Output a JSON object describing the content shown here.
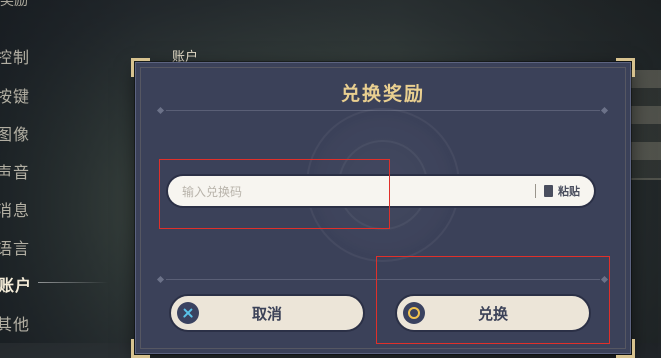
{
  "side_menu": {
    "header": "奖励",
    "items": [
      {
        "label": "控制",
        "active": false
      },
      {
        "label": "按键",
        "active": false
      },
      {
        "label": "图像",
        "active": false
      },
      {
        "label": "声音",
        "active": false
      },
      {
        "label": "消息",
        "active": false
      },
      {
        "label": "语言",
        "active": false
      },
      {
        "label": "账户",
        "active": true
      },
      {
        "label": "其他",
        "active": false
      }
    ]
  },
  "page": {
    "section_label": "账户"
  },
  "dialog": {
    "title": "兑换奖励",
    "input": {
      "placeholder": "输入兑换码",
      "value": ""
    },
    "paste_label": "粘贴",
    "cancel_label": "取消",
    "confirm_label": "兑换",
    "cancel_icon": "x-icon",
    "confirm_icon": "circle-icon"
  },
  "colors": {
    "dialog_bg": "#3b4159",
    "title": "#e9cf90",
    "button_bg": "#ece5d8",
    "annotation": "#e0302a"
  }
}
